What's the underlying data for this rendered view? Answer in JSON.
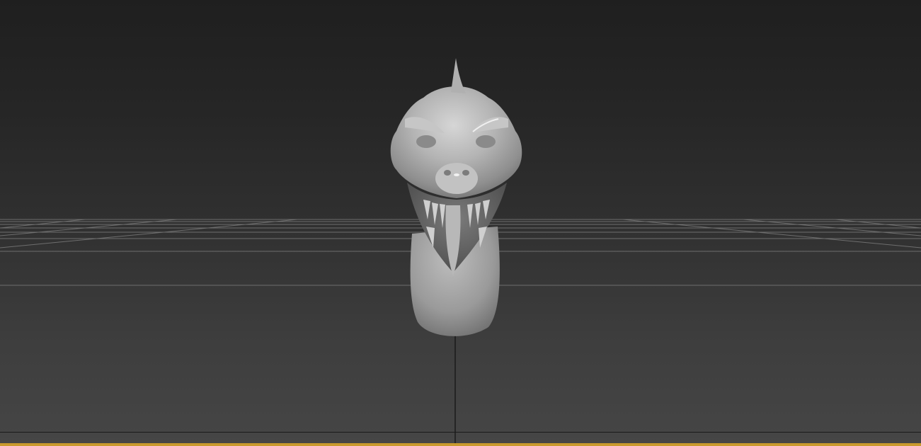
{
  "viewport": {
    "view": "perspective",
    "shading": "default-shading",
    "model": "creature-head-sculpt",
    "grid_visible": true
  },
  "colors": {
    "background_top": "#1f1f1f",
    "background_bottom": "#464646",
    "grid_line": "#6e6e6e",
    "model_surface": "#a9a9a9",
    "active_viewport_border": "#c99a2e",
    "pivot_axis": "#111111"
  }
}
